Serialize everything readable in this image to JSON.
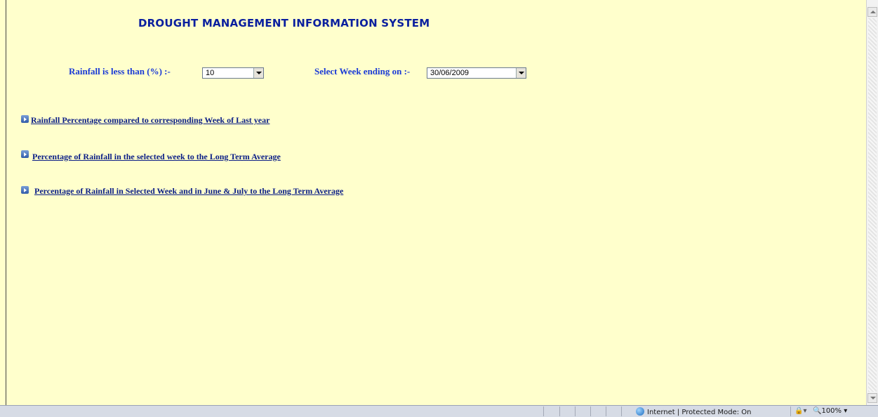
{
  "page": {
    "title": "DROUGHT MANAGEMENT INFORMATION SYSTEM"
  },
  "filters": {
    "rainfall_label": "Rainfall is less than (%) :-",
    "rainfall_value": "10",
    "week_label": "Select Week ending on :-",
    "week_value": "30/06/2009"
  },
  "links": [
    {
      "label": "Rainfall Percentage compared to corresponding Week of Last year"
    },
    {
      "label": "Percentage of Rainfall in the selected week to the Long Term Average"
    },
    {
      "label": "Percentage of Rainfall in Selected Week and in June & July to the Long Term Average"
    }
  ],
  "statusbar": {
    "zone_text": "Internet | Protected Mode: On",
    "zoom_text": "100%",
    "zoom_icon": "magnifier-icon",
    "zone_icon": "globe-icon",
    "security_icon": "lock-icon"
  },
  "colors": {
    "background": "#ffffcc",
    "title": "#0a1f9e",
    "label": "#1a3ad6",
    "link": "#0b1e86"
  }
}
